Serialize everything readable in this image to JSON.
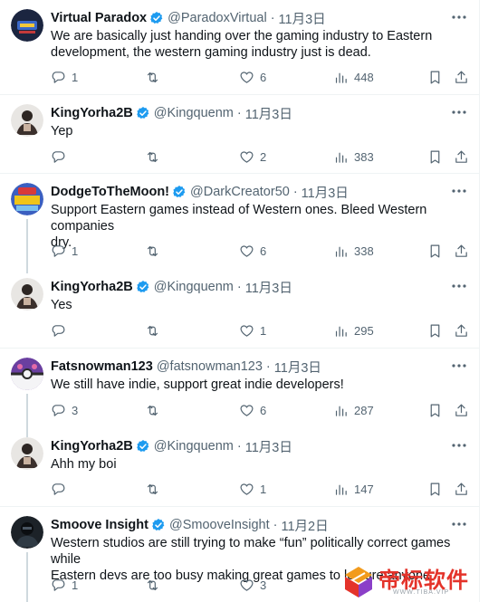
{
  "tweets": [
    {
      "name": "Virtual Paradox",
      "handle": "@ParadoxVirtual",
      "dot": "·",
      "date": "11月3日",
      "avatar_icon": "virtual-paradox-avatar",
      "lines": [
        "We are basically just handing over the gaming industry to Eastern",
        "development, the western gaming industry just is dead."
      ],
      "replies": "1",
      "reposts": "",
      "likes": "6",
      "views": "448"
    },
    {
      "name": "KingYorha2B",
      "handle": "@Kingquenm",
      "dot": "·",
      "date": "11月3日",
      "avatar_icon": "kingyorha2b-avatar",
      "lines": [
        "Yep"
      ],
      "replies": "",
      "reposts": "",
      "likes": "2",
      "views": "383"
    },
    {
      "name": "DodgeToTheMoon!",
      "handle": "@DarkCreator50",
      "dot": "·",
      "date": "11月3日",
      "avatar_icon": "dodgetothemoon-avatar",
      "lines": [
        "Support Eastern games instead of Western ones. Bleed Western companies",
        "dry."
      ],
      "replies": "1",
      "reposts": "",
      "likes": "6",
      "views": "338"
    },
    {
      "name": "KingYorha2B",
      "handle": "@Kingquenm",
      "dot": "·",
      "date": "11月3日",
      "avatar_icon": "kingyorha2b-avatar",
      "lines": [
        "Yes"
      ],
      "replies": "",
      "reposts": "",
      "likes": "1",
      "views": "295"
    },
    {
      "name": "Fatsnowman123",
      "handle": "@fatsnowman123",
      "dot": "·",
      "date": "11月3日",
      "avatar_icon": "masterball-avatar",
      "lines": [
        "We still have indie, support great indie developers!"
      ],
      "replies": "3",
      "reposts": "",
      "likes": "6",
      "views": "287"
    },
    {
      "name": "KingYorha2B",
      "handle": "@Kingquenm",
      "dot": "·",
      "date": "11月3日",
      "avatar_icon": "kingyorha2b-avatar",
      "lines": [
        "Ahh my boi"
      ],
      "replies": "",
      "reposts": "",
      "likes": "1",
      "views": "147"
    },
    {
      "name": "Smoove Insight",
      "handle": "@SmooveInsight",
      "dot": "·",
      "date": "11月2日",
      "avatar_icon": "smoove-insight-avatar",
      "lines": [
        "Western studios are still trying to make “fun” politically correct games while",
        "Eastern devs are too busy making great games to lecture anyone"
      ],
      "replies": "1",
      "reposts": "",
      "likes": "3",
      "views": ""
    }
  ],
  "watermark": {
    "text": "帝标软件",
    "sub": "WWW.TIBA.VIP"
  },
  "colors": {
    "text": "#0f1419",
    "muted": "#536471",
    "verified": "#1d9bf0",
    "divider": "#eff3f4",
    "watermark": "#e4332a"
  }
}
